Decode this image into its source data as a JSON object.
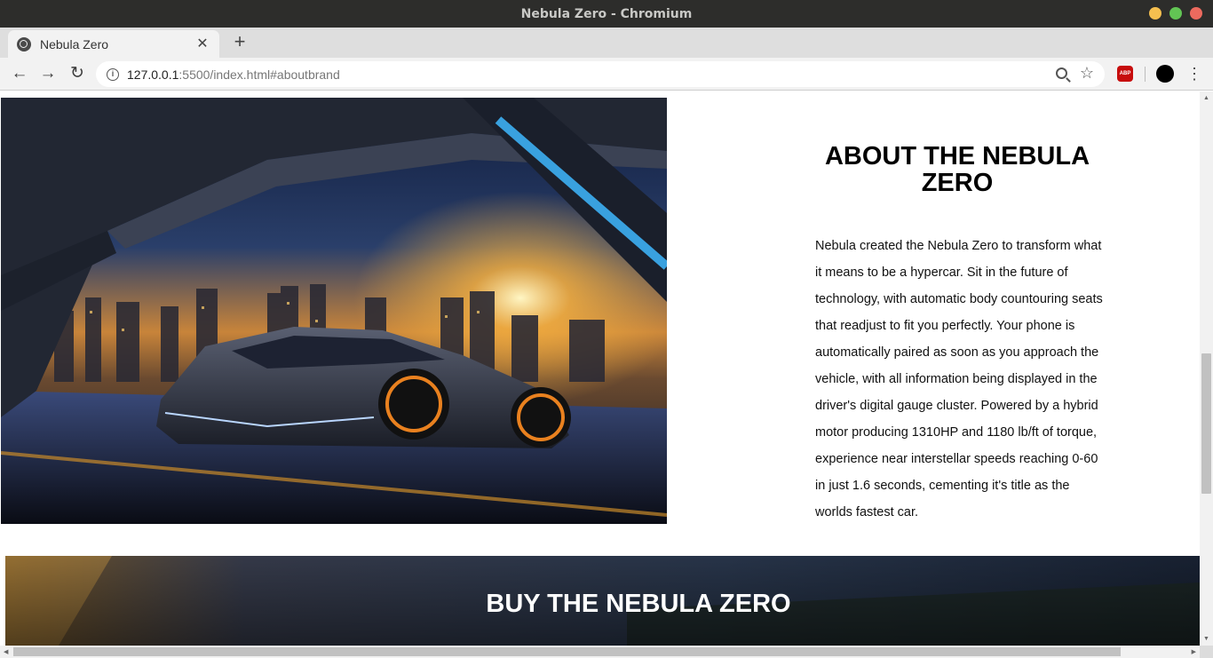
{
  "window": {
    "title": "Nebula Zero - Chromium",
    "controls": {
      "minimize_color": "#f5bf4f",
      "maximize_color": "#62c554",
      "close_color": "#ed6a5e"
    }
  },
  "tab": {
    "title": "Nebula Zero",
    "favicon": "globe-icon",
    "close_glyph": "✕",
    "new_tab_glyph": "+"
  },
  "toolbar": {
    "back_glyph": "←",
    "forward_glyph": "→",
    "reload_glyph": "↻",
    "url_host": "127.0.0.1",
    "url_rest": ":5500/index.html#aboutbrand",
    "extension": "ABP",
    "menu_glyph": "⋮"
  },
  "page": {
    "about_title": "ABOUT THE NEBULA ZERO",
    "about_text": "Nebula created the Nebula Zero to transform what it means to be a hypercar. Sit in the future of technology, with automatic body countouring seats that readjust to fit you perfectly. Your phone is automatically paired as soon as you approach the vehicle, with all information being displayed in the driver's digital gauge cluster. Powered by a hybrid motor producing 1310HP and 1180 lb/ft of torque, experience near interstellar speeds reaching 0-60 in just 1.6 seconds, cementing it's title as the worlds fastest car.",
    "buy_title": "BUY THE NEBULA ZERO"
  },
  "colors": {
    "titlebar": "#2d2d2b",
    "tabstrip": "#dedede",
    "toolbar": "#f2f2f2",
    "abp_badge": "#c70d0d"
  }
}
